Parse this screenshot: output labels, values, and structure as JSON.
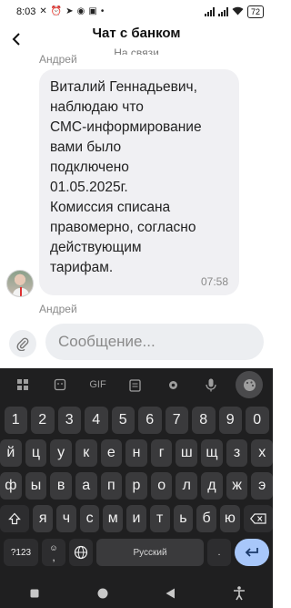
{
  "status_bar": {
    "time": "8:03",
    "left_icons": [
      "mute-icon",
      "alarm-icon",
      "telegram-icon",
      "whatsapp-icon",
      "vk-icon",
      "dot-icon"
    ],
    "battery": "72"
  },
  "header": {
    "title": "Чат с банком",
    "subtitle": "На связи"
  },
  "chat": {
    "messages": [
      {
        "sender": "Андрей",
        "text": "Виталий Геннадьевич,\nнаблюдаю что\nСМС-информирование\nвами было\nподключено\n01.05.2025г.\nКомиссия списана\nправомерно, согласно\nдействующим\nтарифам.",
        "time": "07:58"
      },
      {
        "sender": "Андрей"
      }
    ]
  },
  "input": {
    "placeholder": "Сообщение..."
  },
  "keyboard": {
    "toolbar": [
      "grid-icon",
      "sticker-icon",
      "gif-icon",
      "clipboard-icon",
      "gear-icon",
      "mic-icon",
      "palette-icon"
    ],
    "gif_label": "GIF",
    "rows": [
      [
        "1",
        "2",
        "3",
        "4",
        "5",
        "6",
        "7",
        "8",
        "9",
        "0"
      ],
      [
        "й",
        "ц",
        "у",
        "к",
        "е",
        "н",
        "г",
        "ш",
        "щ",
        "з",
        "х"
      ],
      [
        "ф",
        "ы",
        "в",
        "а",
        "п",
        "р",
        "о",
        "л",
        "д",
        "ж",
        "э"
      ],
      [
        "я",
        "ч",
        "с",
        "м",
        "и",
        "т",
        "ь",
        "б",
        "ю"
      ]
    ],
    "sym_label": "?123",
    "emoji_comma": ",",
    "space_label": "Русский",
    "period_label": "."
  },
  "colors": {
    "bubble": "#f0f0f3",
    "keyboard_bg": "#1f1f20",
    "key_bg": "#3a3a3c",
    "enter_key": "#a8c7fa"
  }
}
